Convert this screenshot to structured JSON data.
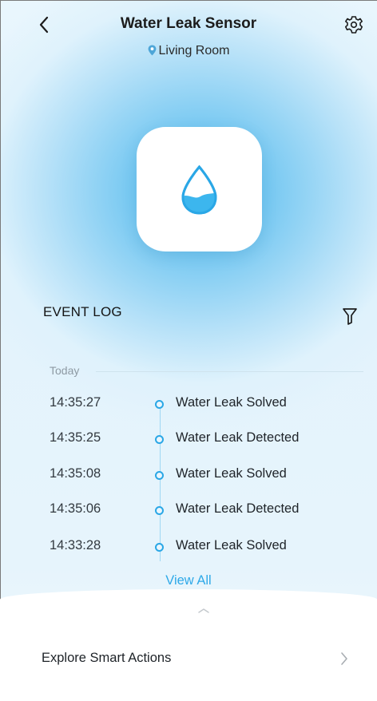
{
  "header": {
    "title": "Water Leak Sensor",
    "location": "Living Room",
    "back_icon": "chevron-left-icon",
    "settings_icon": "gear-icon"
  },
  "device": {
    "icon": "water-drop-icon",
    "accent_color": "#2aa7e6"
  },
  "event_log": {
    "title": "EVENT LOG",
    "filter_icon": "filter-icon",
    "day": "Today",
    "events": [
      {
        "time": "14:35:27",
        "label": "Water Leak Solved"
      },
      {
        "time": "14:35:25",
        "label": "Water Leak Detected"
      },
      {
        "time": "14:35:08",
        "label": "Water Leak Solved"
      },
      {
        "time": "14:35:06",
        "label": "Water Leak Detected"
      },
      {
        "time": "14:33:28",
        "label": "Water Leak Solved"
      }
    ],
    "view_all": "View All"
  },
  "bottom_sheet": {
    "handle_icon": "chevron-up-icon",
    "smart_actions": {
      "label": "Explore Smart Actions",
      "icon": "chevron-right-icon"
    }
  }
}
